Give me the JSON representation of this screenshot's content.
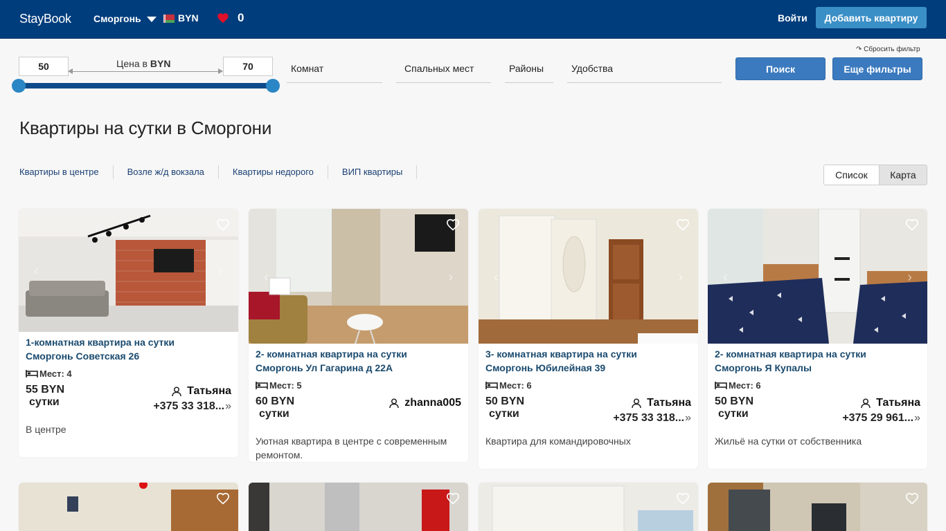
{
  "header": {
    "logo": "StayBook",
    "city": "Сморгонь",
    "currency": "BYN",
    "favorites_count": "0",
    "login": "Войти",
    "add_button": "Добавить квартиру"
  },
  "filters": {
    "reset": "↷ Сбросить фильтр",
    "price_min": "50",
    "price_max": "70",
    "price_label_prefix": "Цена в",
    "price_label_currency": "BYN",
    "price_range_selected": [
      50,
      70
    ],
    "rooms": "Комнат",
    "beds": "Спальных мест",
    "districts": "Районы",
    "amenities": "Удобства",
    "search_button": "Поиск",
    "more_filters_button": "Еще фильтры"
  },
  "page_title": "Квартиры на сутки в Сморгони",
  "quick_links": [
    "Квартиры в центре",
    "Возле ж/д вокзала",
    "Квартиры недорого",
    "ВИП квартиры"
  ],
  "view": {
    "list": "Список",
    "map": "Карта"
  },
  "listings": [
    {
      "title_line1": "1-комнатная квартира на сутки",
      "title_line2": "Сморгонь Советская 26",
      "places": "Мест: 4",
      "price": "55 BYN",
      "per": "сутки",
      "owner": "Татьяна",
      "phone": "+375 33 318...",
      "description": "В центре"
    },
    {
      "title_line1": "2- комнатная квартира на сутки",
      "title_line2": "Сморгонь Ул Гагарина д 22А",
      "places": "Мест: 5",
      "price": "60 BYN",
      "per": "сутки",
      "owner": "zhanna005",
      "phone": "",
      "description": "Уютная квартира в центре с современным ремонтом."
    },
    {
      "title_line1": "3- комнатная квартира на сутки",
      "title_line2": "Сморгонь Юбилейная 39",
      "places": "Мест: 6",
      "price": "50 BYN",
      "per": "сутки",
      "owner": "Татьяна",
      "phone": "+375 33 318...",
      "description": "Квартира для командировочных"
    },
    {
      "title_line1": "2- комнатная квартира на сутки",
      "title_line2": "Сморгонь Я Купалы",
      "places": "Мест: 6",
      "price": "50 BYN",
      "per": "сутки",
      "owner": "Татьяна",
      "phone": "+375 29 961...",
      "description": "Жильё на сутки от собственника"
    }
  ],
  "colors": {
    "header_bg": "#003d7c",
    "accent_button": "#3b8fc7",
    "title_link": "#1a4a6e",
    "heart": "#e0102a"
  }
}
